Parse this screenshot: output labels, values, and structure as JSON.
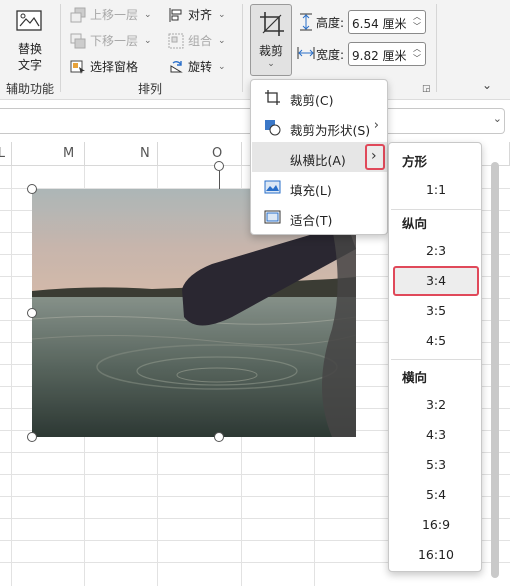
{
  "ribbon": {
    "replace_text": "替换\n文字",
    "replace_text_line1": "替换",
    "replace_text_line2": "文字",
    "group_aux": "辅助功能",
    "bring_forward": "上移一层",
    "send_backward": "下移一层",
    "selection_pane": "选择窗格",
    "align": "对齐",
    "group": "组合",
    "rotate": "旋转",
    "group_arrange": "排列",
    "crop": "裁剪",
    "height_label": "高度:",
    "height_value": "6.54 厘米",
    "width_label": "宽度:",
    "width_value": "9.82 厘米"
  },
  "columns": [
    "L",
    "M",
    "N",
    "O"
  ],
  "crop_menu": {
    "items": [
      {
        "label": "裁剪(C)",
        "icon": "crop-icon"
      },
      {
        "label": "裁剪为形状(S)",
        "icon": "shape-crop-icon",
        "submenu": true
      },
      {
        "label": "纵横比(A)",
        "icon": "",
        "submenu": true,
        "active": true
      },
      {
        "label": "填充(L)",
        "icon": "fill-icon"
      },
      {
        "label": "适合(T)",
        "icon": "fit-icon"
      }
    ]
  },
  "aspect_menu": {
    "square_header": "方形",
    "square": [
      "1:1"
    ],
    "portrait_header": "纵向",
    "portrait": [
      "2:3",
      "3:4",
      "3:5",
      "4:5"
    ],
    "landscape_header": "横向",
    "landscape": [
      "3:2",
      "4:3",
      "5:3",
      "5:4",
      "16:9",
      "16:10"
    ],
    "selected": "3:4"
  },
  "colors": {
    "highlight_red": "#e0495a",
    "ribbon_bg": "#f3f3f3"
  }
}
